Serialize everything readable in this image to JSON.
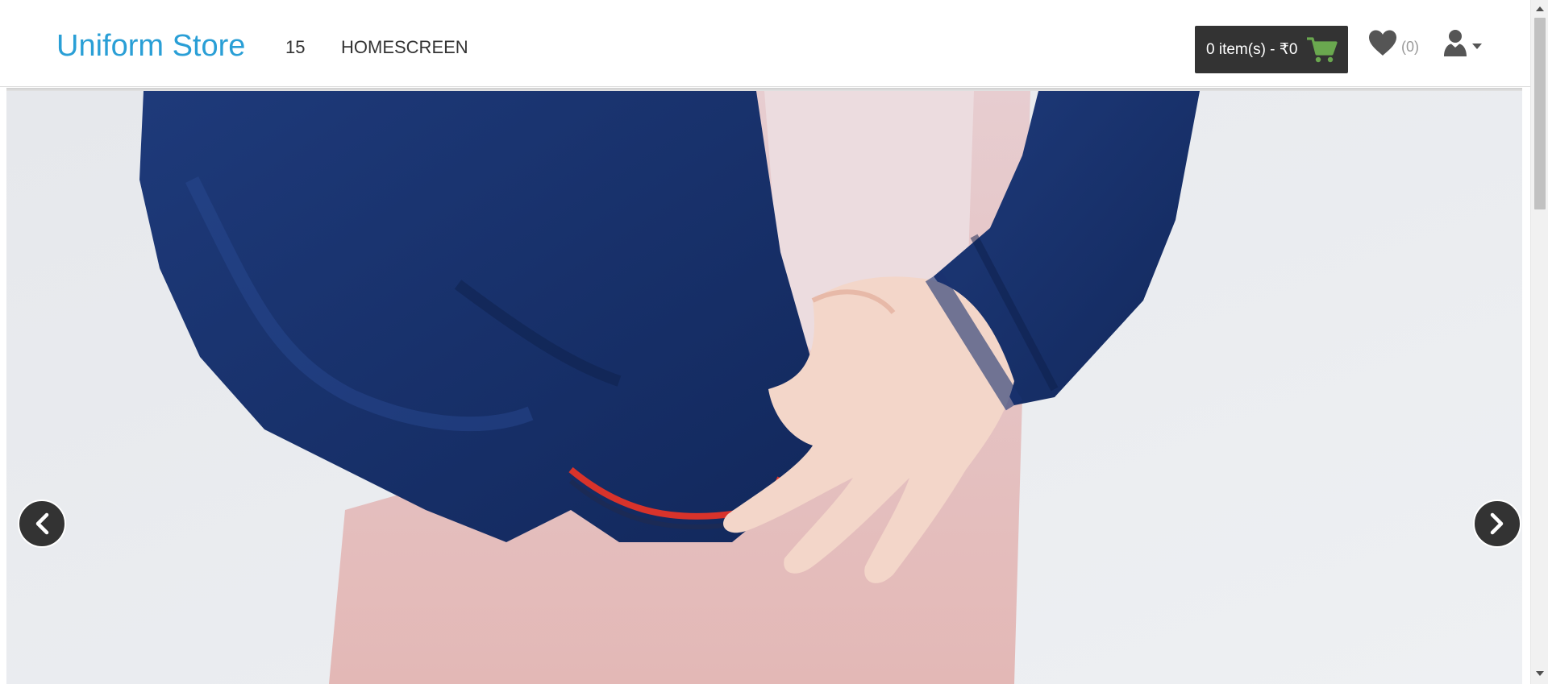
{
  "header": {
    "brand": "Uniform Store",
    "nav": [
      {
        "label": "15"
      },
      {
        "label": "HOMESCREEN"
      }
    ],
    "cart": {
      "label": "0 item(s) - ₹0",
      "icon": "shopping-cart-icon",
      "icon_color": "#6aa84f"
    },
    "wishlist": {
      "icon": "heart-icon",
      "count": "(0)"
    },
    "account": {
      "icon": "user-icon",
      "caret": "caret-down-icon"
    }
  },
  "hero": {
    "image": "child-wearing-navy-school-cardigan",
    "prev_icon": "chevron-left-icon",
    "next_icon": "chevron-right-icon"
  },
  "colors": {
    "brand": "#2a9fd6",
    "dark": "#333333",
    "muted": "#999999"
  }
}
